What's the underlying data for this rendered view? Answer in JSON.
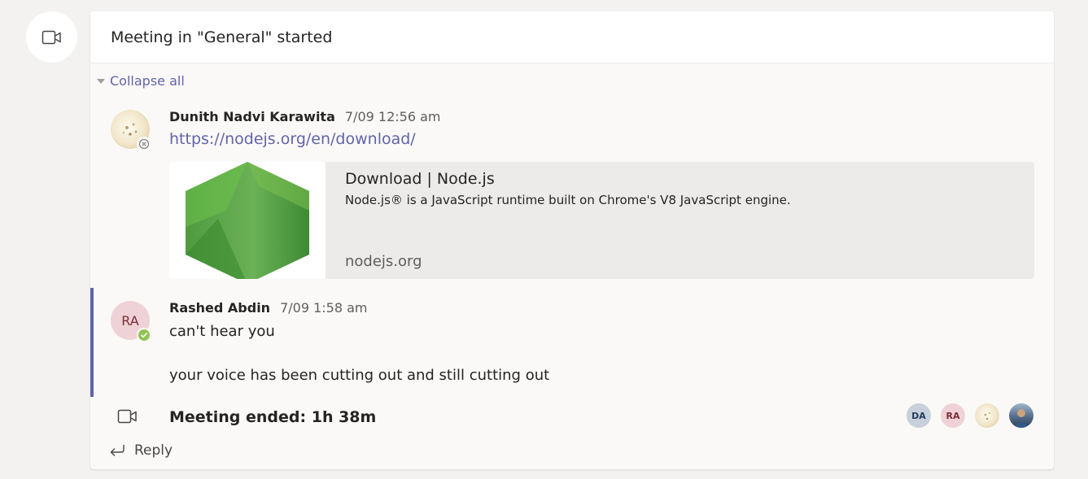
{
  "header": {
    "title": "Meeting in \"General\" started"
  },
  "collapse_label": "Collapse all",
  "messages": [
    {
      "author": "Dunith Nadvi Karawita",
      "time": "7/09 12:56 am",
      "link": "https://nodejs.org/en/download/",
      "preview": {
        "title": "Download | Node.js",
        "description": "Node.js® is a JavaScript runtime built on Chrome's V8 JavaScript engine.",
        "site": "nodejs.org"
      }
    },
    {
      "author": "Rashed Abdin",
      "initials": "RA",
      "time": "7/09 1:58 am",
      "lines": [
        "can't hear you",
        "your voice has been cutting out and still cutting out"
      ]
    }
  ],
  "meeting_ended": "Meeting ended: 1h 38m",
  "participants": [
    {
      "initials": "DA",
      "bg": "#c8d1db",
      "fg": "#243a5e"
    },
    {
      "initials": "RA",
      "bg": "#efd2d7",
      "fg": "#7a2e3a"
    }
  ],
  "reply_label": "Reply",
  "colors": {
    "accent": "#6264a7",
    "presence_available": "#92c353",
    "node_green": "#5fa04e"
  }
}
